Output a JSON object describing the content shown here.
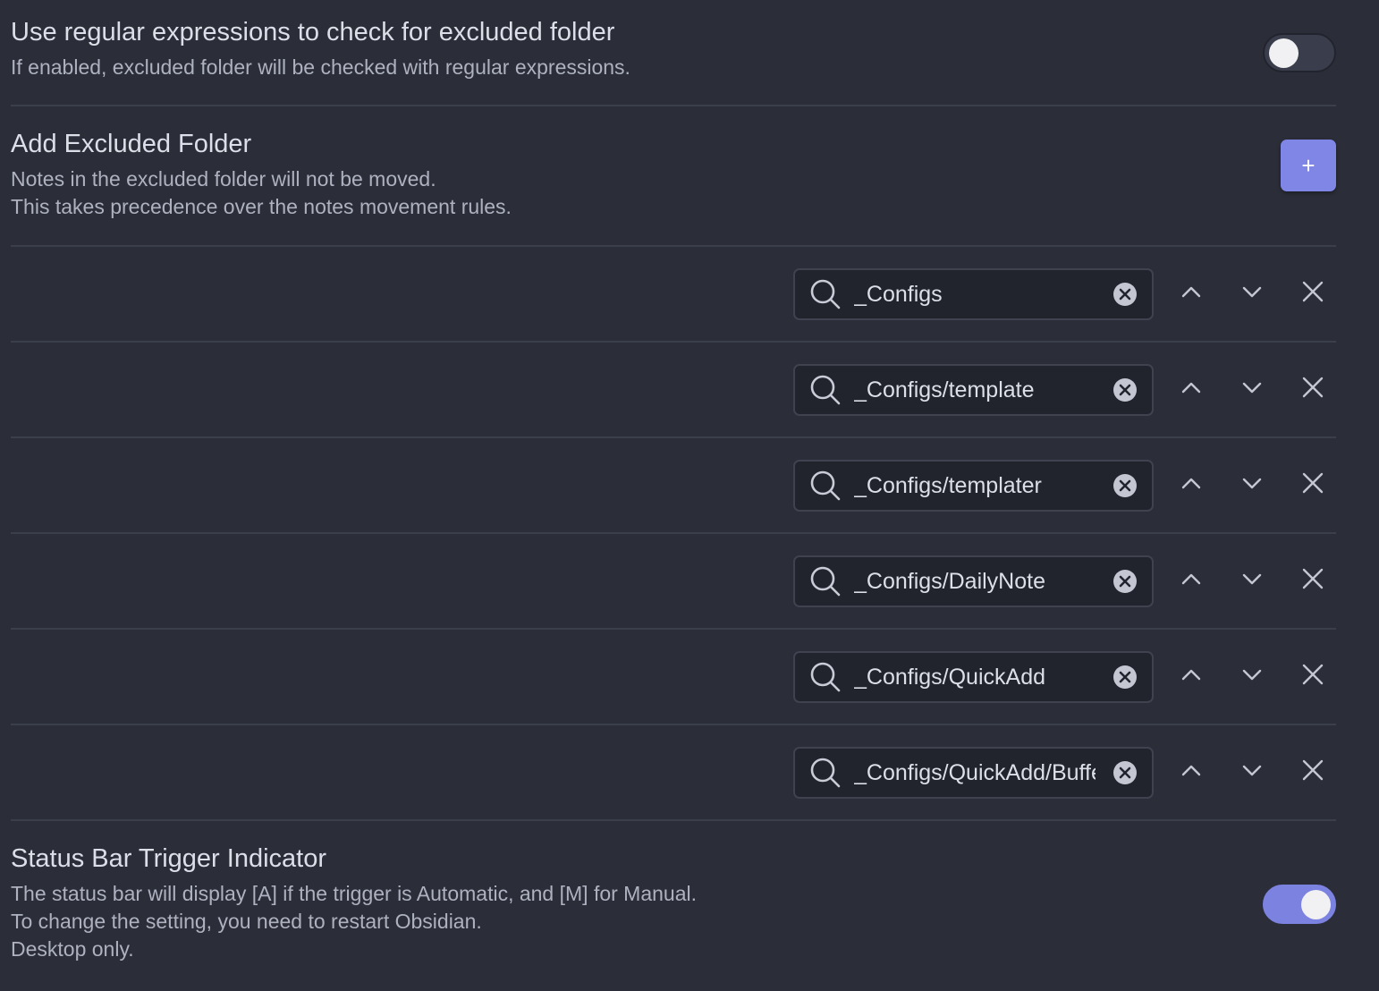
{
  "settings": {
    "regex": {
      "name": "Use regular expressions to check for excluded folder",
      "desc": "If enabled, excluded folder will be checked with regular expressions.",
      "enabled": false
    },
    "add_excluded": {
      "name": "Add Excluded Folder",
      "desc_line1": "Notes in the excluded folder will not be moved.",
      "desc_line2": "This takes precedence over the notes movement rules.",
      "button_label": "+"
    },
    "excluded_folders": [
      "_Configs",
      "_Configs/template",
      "_Configs/templater",
      "_Configs/DailyNote",
      "_Configs/QuickAdd",
      "_Configs/QuickAdd/Buffer"
    ],
    "status_bar": {
      "name": "Status Bar Trigger Indicator",
      "desc_line1": "The status bar will display [A] if the trigger is Automatic, and [M] for Manual.",
      "desc_line2": "To change the setting, you need to restart Obsidian.",
      "desc_line3": "Desktop only.",
      "enabled": true
    }
  },
  "icons": {
    "search": "search-icon",
    "clear": "clear-icon",
    "up": "chevron-up-icon",
    "down": "chevron-down-icon",
    "delete": "close-icon"
  },
  "colors": {
    "background": "#2b2d38",
    "accent": "#7f86e6",
    "input_bg": "#22242d"
  }
}
